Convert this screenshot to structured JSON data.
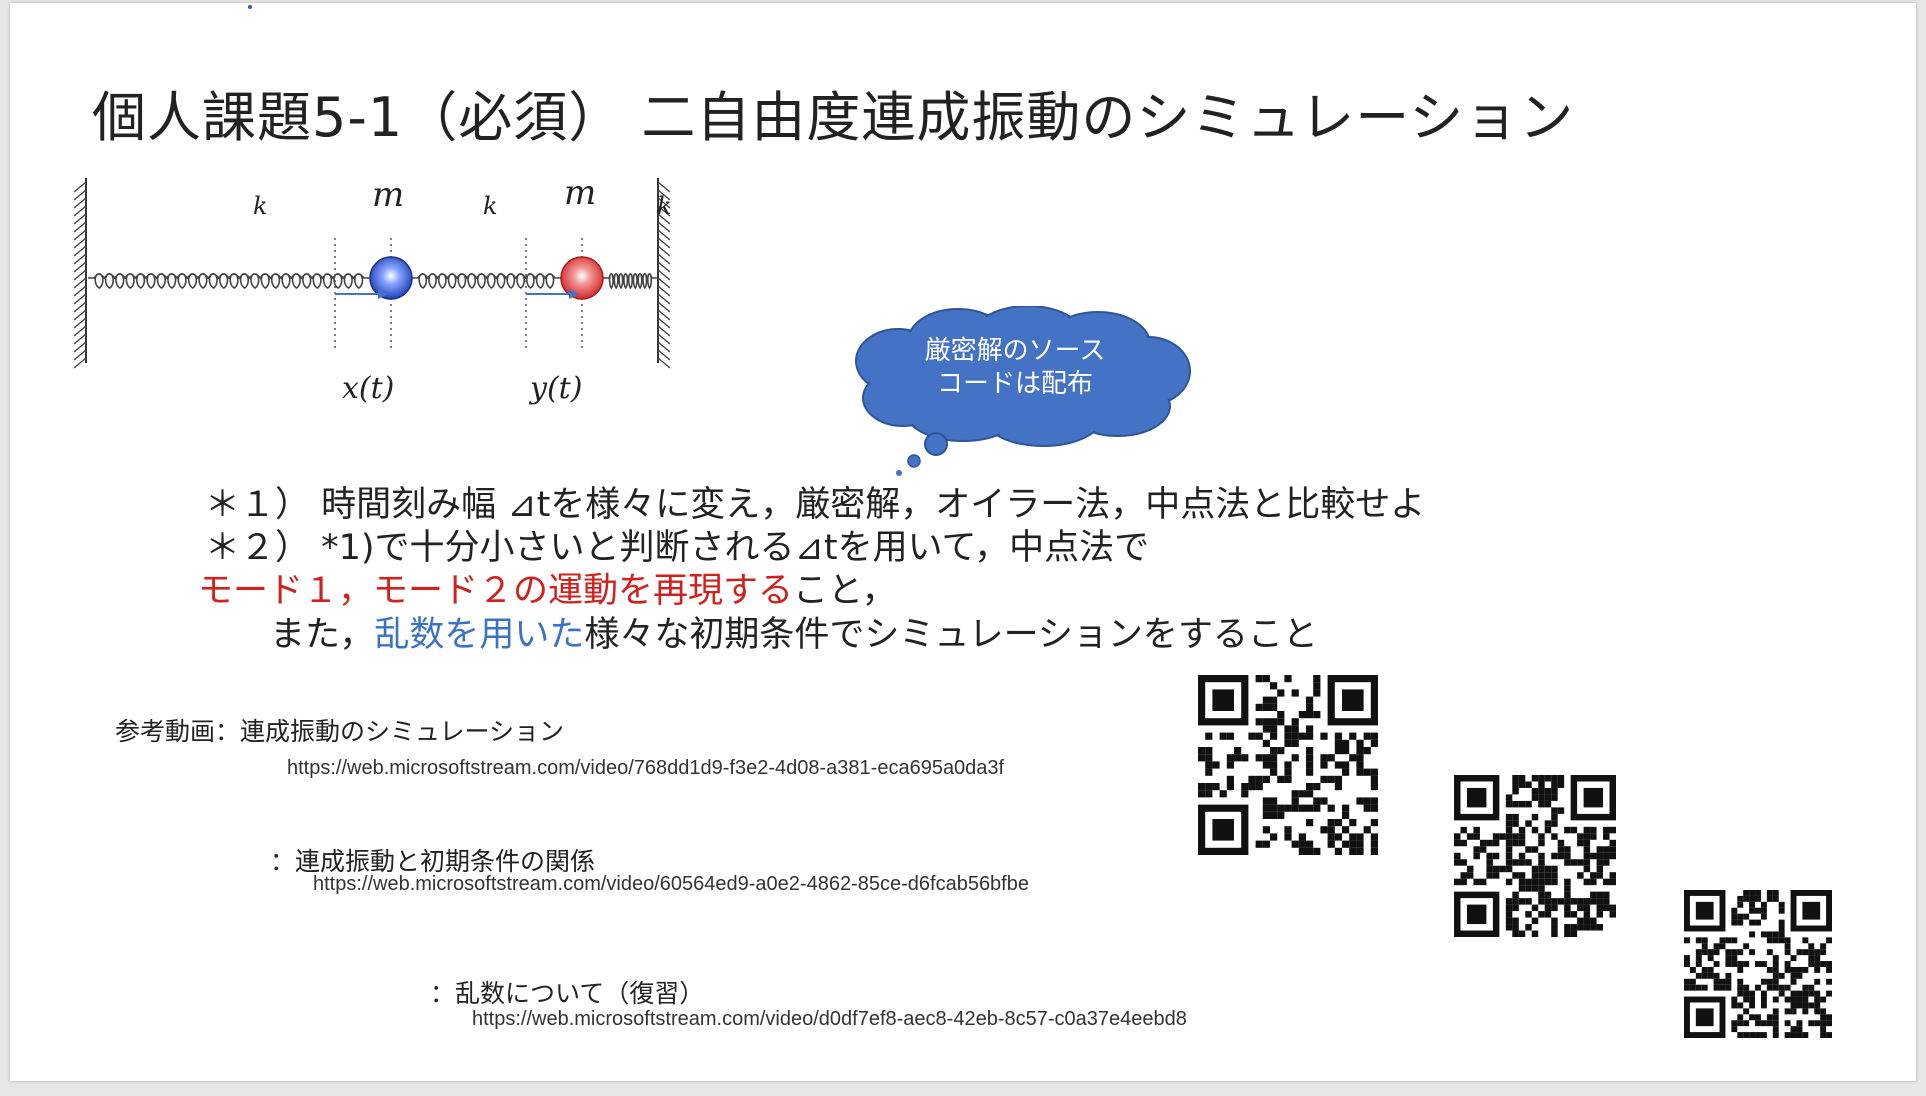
{
  "slide": {
    "title": "個人課題5-1（必須） 二自由度連成振動のシミュレーション"
  },
  "diagram": {
    "spring_label": "k",
    "mass_label": "m",
    "disp_x": "x(t)",
    "disp_y": "y(t)",
    "colors": {
      "mass1": "#2a4fc0",
      "mass2": "#e03b3b",
      "arrow": "#4472c4",
      "cloud": "#4472c4"
    }
  },
  "cloud": {
    "line1": "厳密解のソース",
    "line2": "コードは配布"
  },
  "tasks": {
    "t1": "＊１） 時間刻み幅 ⊿tを様々に変え，厳密解，オイラー法，中点法と比較せよ",
    "t2": "＊２） *1)で十分小さいと判断される⊿tを用いて，中点法で",
    "t3_red": "モード１，モード２の運動を再現する",
    "t3_rest": "こと，",
    "t4_pre": "また，",
    "t4_blue": "乱数を用いた",
    "t4_post": "様々な初期条件でシミュレーションをすること"
  },
  "references": {
    "r1_label": "参考動画：連成振動のシミュレーション",
    "r1_url": "https://web.microsoftstream.com/video/768dd1d9-f3e2-4d08-a381-eca695a0da3f",
    "r2_label": "：連成振動と初期条件の関係",
    "r2_url": "https://web.microsoftstream.com/video/60564ed9-a0e2-4862-85ce-d6fcab56bfbe",
    "r3_label": "：乱数について（復習）",
    "r3_url": "https://web.microsoftstream.com/video/d0df7ef8-aec8-42eb-8c57-c0a37e4eebd8"
  },
  "icons": [
    "qr-code-icon",
    "wall-icon",
    "spring-icon",
    "mass-ball-icon",
    "arrow-right-icon",
    "thought-cloud-icon"
  ]
}
